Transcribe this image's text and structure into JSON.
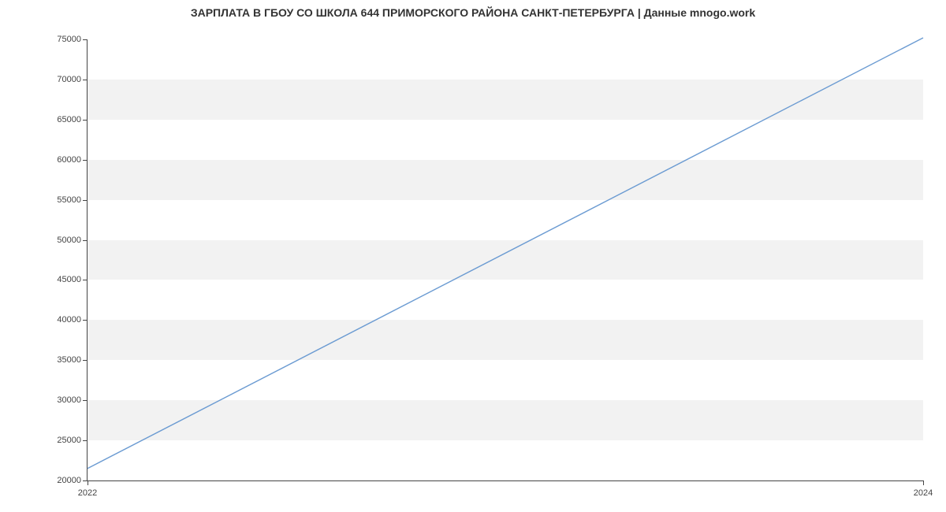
{
  "chart_data": {
    "type": "line",
    "title": "ЗАРПЛАТА В ГБОУ СО ШКОЛА 644 ПРИМОРСКОГО РАЙОНА САНКТ-ПЕТЕРБУРГА | Данные mnogo.work",
    "x": [
      2022,
      2024
    ],
    "values": [
      21500,
      75200
    ],
    "xlabel": "",
    "ylabel": "",
    "xlim": [
      2022,
      2024
    ],
    "ylim": [
      20000,
      75000
    ],
    "yticks": [
      20000,
      25000,
      30000,
      35000,
      40000,
      45000,
      50000,
      55000,
      60000,
      65000,
      70000,
      75000
    ],
    "xticks": [
      2022,
      2024
    ],
    "line_color": "#6b9bd2",
    "grid_band_color": "#f2f2f2"
  }
}
